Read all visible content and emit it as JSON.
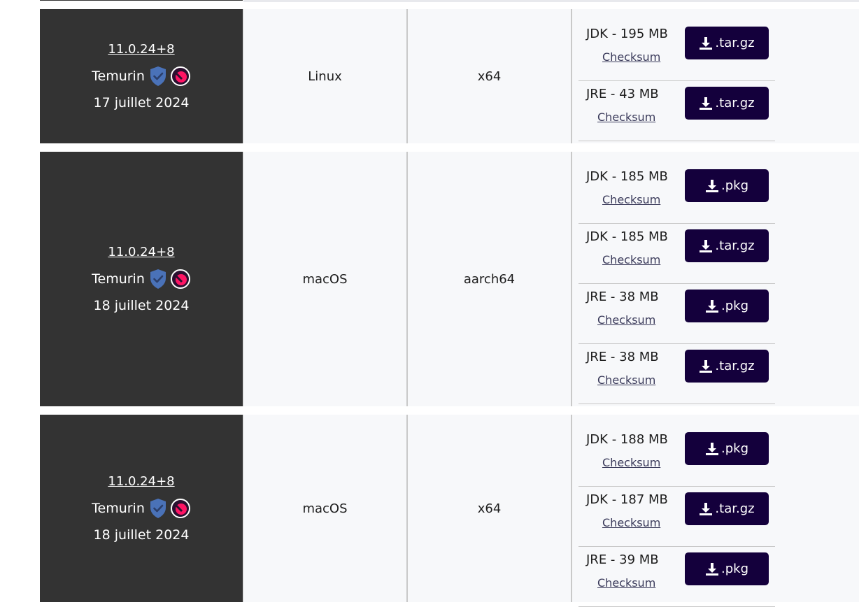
{
  "colors": {
    "info_bg": "#333333",
    "row_bg": "#f7f8fa",
    "button_bg": "#14003c",
    "shield": "#4a72b8",
    "badge": "#ff1464"
  },
  "releases": [
    {
      "version": "11.0.24+8",
      "vendor": "Temurin",
      "date": "17 juillet 2024",
      "os": "Linux",
      "arch": "x64",
      "downloads": [
        {
          "label": "JDK - 195 MB",
          "checksum": "Checksum",
          "button": ".tar.gz",
          "icon": "download-icon"
        },
        {
          "label": "JRE - 43 MB",
          "checksum": "Checksum",
          "button": ".tar.gz",
          "icon": "download-icon"
        }
      ]
    },
    {
      "version": "11.0.24+8",
      "vendor": "Temurin",
      "date": "18 juillet 2024",
      "os": "macOS",
      "arch": "aarch64",
      "downloads": [
        {
          "label": "JDK - 185 MB",
          "checksum": "Checksum",
          "button": ".pkg",
          "icon": "download-icon"
        },
        {
          "label": "JDK - 185 MB",
          "checksum": "Checksum",
          "button": ".tar.gz",
          "icon": "download-icon"
        },
        {
          "label": "JRE - 38 MB",
          "checksum": "Checksum",
          "button": ".pkg",
          "icon": "download-icon"
        },
        {
          "label": "JRE - 38 MB",
          "checksum": "Checksum",
          "button": ".tar.gz",
          "icon": "download-icon"
        }
      ]
    },
    {
      "version": "11.0.24+8",
      "vendor": "Temurin",
      "date": "18 juillet 2024",
      "os": "macOS",
      "arch": "x64",
      "downloads": [
        {
          "label": "JDK - 188 MB",
          "checksum": "Checksum",
          "button": ".pkg",
          "icon": "download-icon"
        },
        {
          "label": "JDK - 187 MB",
          "checksum": "Checksum",
          "button": ".tar.gz",
          "icon": "download-icon"
        },
        {
          "label": "JRE - 39 MB",
          "checksum": "Checksum",
          "button": ".pkg",
          "icon": "download-icon"
        }
      ]
    }
  ]
}
